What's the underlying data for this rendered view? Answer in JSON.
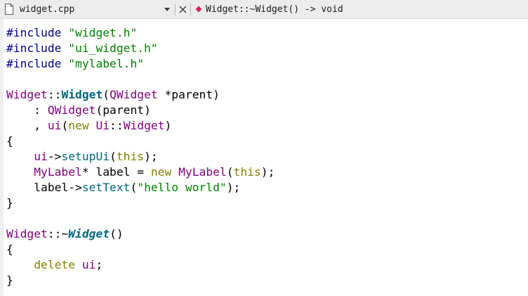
{
  "tab": {
    "file_icon": "file-icon",
    "filename": "widget.cpp",
    "dropdown_icon": "chevron-down-icon",
    "close_icon": "close-icon",
    "symbol_icon": "member-function-icon",
    "symbol": "Widget::~Widget() -> void"
  },
  "colors": {
    "preprocessor": "#000080",
    "string": "#008000",
    "type": "#800080",
    "keyword": "#808000",
    "function": "#00677c",
    "plain": "#000000",
    "symbol_marker": "#d6245a"
  },
  "code": {
    "lines": [
      [
        {
          "t": "#include ",
          "c": "pp"
        },
        {
          "t": "\"widget.h\"",
          "c": "str"
        }
      ],
      [
        {
          "t": "#include ",
          "c": "pp"
        },
        {
          "t": "\"ui_widget.h\"",
          "c": "str"
        }
      ],
      [
        {
          "t": "#include ",
          "c": "pp"
        },
        {
          "t": "\"mylabel.h\"",
          "c": "str"
        }
      ],
      [],
      [
        {
          "t": "Widget",
          "c": "type"
        },
        {
          "t": "::",
          "c": "plain"
        },
        {
          "t": "Widget",
          "c": "fbold"
        },
        {
          "t": "(",
          "c": "plain"
        },
        {
          "t": "QWidget",
          "c": "type"
        },
        {
          "t": " *parent)",
          "c": "plain"
        }
      ],
      [
        {
          "t": "    : ",
          "c": "plain"
        },
        {
          "t": "QWidget",
          "c": "type"
        },
        {
          "t": "(parent)",
          "c": "plain"
        }
      ],
      [
        {
          "t": "    , ",
          "c": "plain"
        },
        {
          "t": "ui",
          "c": "type"
        },
        {
          "t": "(",
          "c": "plain"
        },
        {
          "t": "new",
          "c": "kw"
        },
        {
          "t": " ",
          "c": "plain"
        },
        {
          "t": "Ui",
          "c": "type"
        },
        {
          "t": "::",
          "c": "plain"
        },
        {
          "t": "Widget",
          "c": "type"
        },
        {
          "t": ")",
          "c": "plain"
        }
      ],
      [
        {
          "t": "{",
          "c": "plain"
        }
      ],
      [
        {
          "t": "    ",
          "c": "plain"
        },
        {
          "t": "ui",
          "c": "type"
        },
        {
          "t": "->",
          "c": "plain"
        },
        {
          "t": "setupUi",
          "c": "func"
        },
        {
          "t": "(",
          "c": "plain"
        },
        {
          "t": "this",
          "c": "kw"
        },
        {
          "t": ");",
          "c": "plain"
        }
      ],
      [
        {
          "t": "    ",
          "c": "plain"
        },
        {
          "t": "MyLabel",
          "c": "type"
        },
        {
          "t": "* label = ",
          "c": "plain"
        },
        {
          "t": "new",
          "c": "kw"
        },
        {
          "t": " ",
          "c": "plain"
        },
        {
          "t": "MyLabel",
          "c": "type"
        },
        {
          "t": "(",
          "c": "plain"
        },
        {
          "t": "this",
          "c": "kw"
        },
        {
          "t": ");",
          "c": "plain"
        }
      ],
      [
        {
          "t": "    label->",
          "c": "plain"
        },
        {
          "t": "setText",
          "c": "func"
        },
        {
          "t": "(",
          "c": "plain"
        },
        {
          "t": "\"hello world\"",
          "c": "str"
        },
        {
          "t": ");",
          "c": "plain"
        }
      ],
      [
        {
          "t": "}",
          "c": "plain"
        }
      ],
      [],
      [
        {
          "t": "Widget",
          "c": "type"
        },
        {
          "t": "::~",
          "c": "plain"
        },
        {
          "t": "Widget",
          "c": "fbi"
        },
        {
          "t": "()",
          "c": "plain"
        }
      ],
      [
        {
          "t": "{",
          "c": "plain"
        }
      ],
      [
        {
          "t": "    ",
          "c": "plain"
        },
        {
          "t": "delete",
          "c": "kw"
        },
        {
          "t": " ",
          "c": "plain"
        },
        {
          "t": "ui",
          "c": "type"
        },
        {
          "t": ";",
          "c": "plain"
        }
      ],
      [
        {
          "t": "}",
          "c": "plain"
        }
      ]
    ]
  }
}
